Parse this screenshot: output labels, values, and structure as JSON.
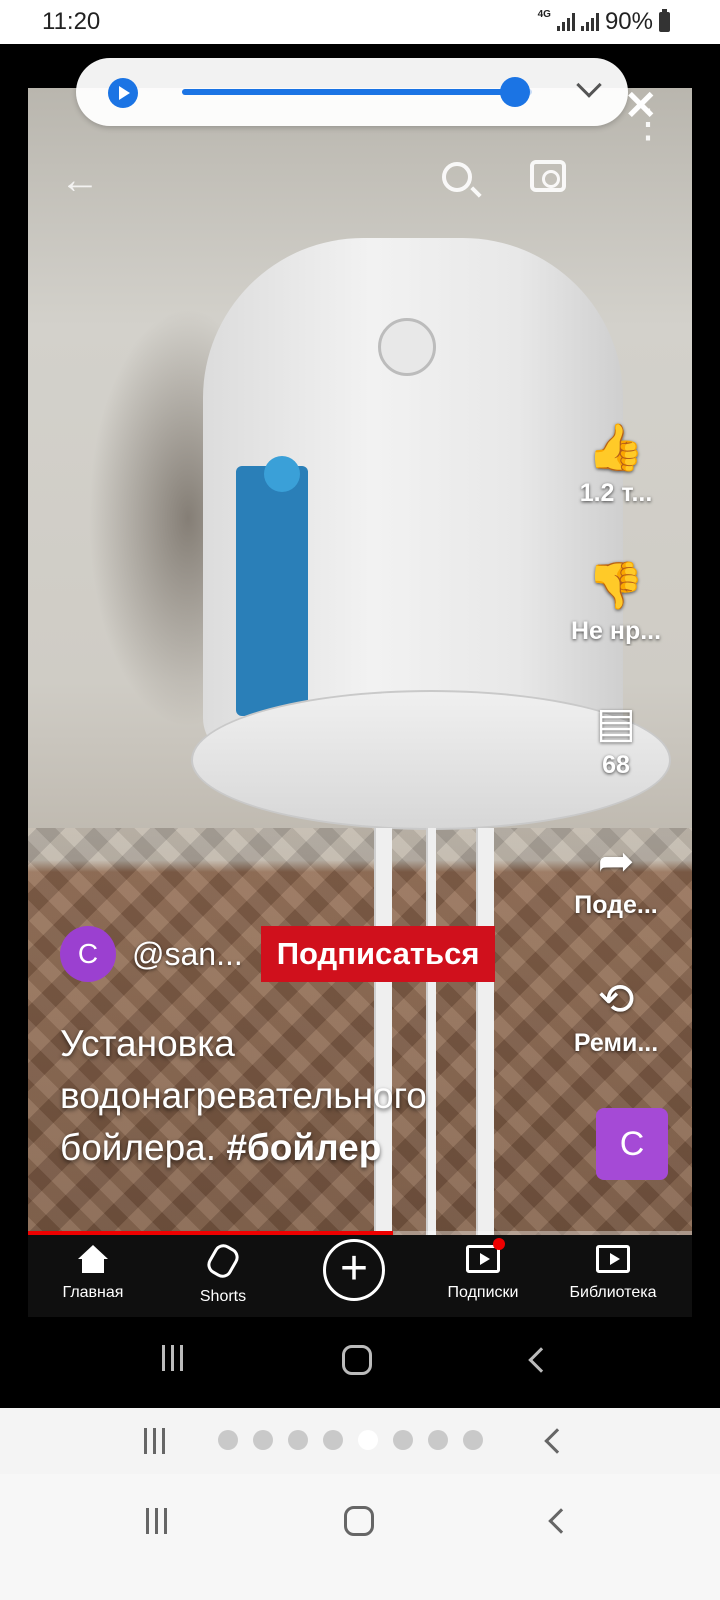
{
  "status_bar": {
    "time": "11:20",
    "network": "4G",
    "battery": "90%"
  },
  "media_control": {
    "progress_fraction": 0.95
  },
  "video": {
    "channel_avatar": "C",
    "channel_handle": "@san...",
    "subscribe_label": "Подписаться",
    "title_plain": "Установка водонагревательного бойлера.",
    "title_hashtag": "#бойлер",
    "small_avatar": "C",
    "playback_fraction": 0.55
  },
  "actions": {
    "like": "1.2 т...",
    "dislike": "Не нр...",
    "comments": "68",
    "share": "Поде...",
    "remix": "Реми..."
  },
  "bottom_nav": {
    "items": [
      {
        "label": "Главная",
        "icon": "home-icon"
      },
      {
        "label": "Shorts",
        "icon": "shorts-icon"
      },
      {
        "label": "",
        "icon": "create-icon"
      },
      {
        "label": "Подписки",
        "icon": "subscriptions-icon"
      },
      {
        "label": "Библиотека",
        "icon": "library-icon"
      }
    ]
  },
  "viewer": {
    "page_count": 8,
    "current_page": 5
  },
  "colors": {
    "accent_blue": "#1b74e4",
    "subscribe_red": "#d0101c",
    "avatar_purple": "#9b40d0"
  }
}
